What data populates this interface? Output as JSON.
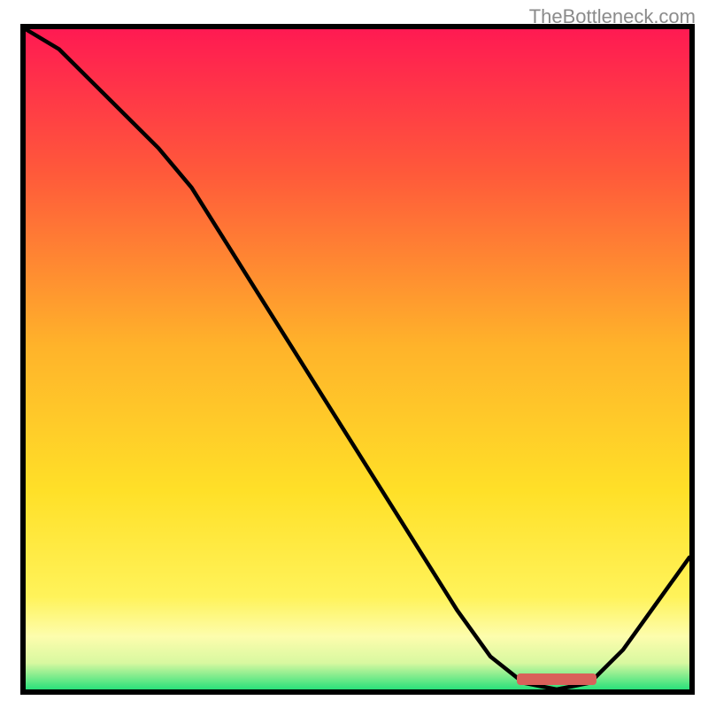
{
  "attribution": "TheBottleneck.com",
  "chart_data": {
    "type": "line",
    "title": "",
    "xlabel": "",
    "ylabel": "",
    "xlim": [
      0,
      100
    ],
    "ylim": [
      0,
      100
    ],
    "notes": "Curve value is 'bottleneck/error' — 0 at the trough (optimal point, green band), high at red. Background gradient encodes same scale (red=high, green=low). X-axis is an unlabeled configuration sweep; the small red bar marks the optimal-range indicator near x≈80.",
    "x": [
      0,
      5,
      10,
      15,
      20,
      25,
      30,
      35,
      40,
      45,
      50,
      55,
      60,
      65,
      70,
      75,
      80,
      85,
      90,
      95,
      100
    ],
    "values": [
      102,
      97,
      92,
      87,
      82,
      76,
      68,
      60,
      52,
      44,
      36,
      28,
      20,
      12,
      5,
      1,
      0,
      1,
      6,
      13,
      20
    ],
    "gradient_stops": [
      {
        "pct": 0,
        "color": "#ff1a52"
      },
      {
        "pct": 22,
        "color": "#ff5a3a"
      },
      {
        "pct": 48,
        "color": "#ffb32a"
      },
      {
        "pct": 70,
        "color": "#ffe028"
      },
      {
        "pct": 86,
        "color": "#fff35a"
      },
      {
        "pct": 92,
        "color": "#fdfdad"
      },
      {
        "pct": 96,
        "color": "#d8f8a0"
      },
      {
        "pct": 100,
        "color": "#29e07a"
      }
    ],
    "optimal_marker": {
      "x_start": 74,
      "x_end": 86,
      "color": "#d9605a"
    },
    "axes_visible": false,
    "grid": false
  }
}
